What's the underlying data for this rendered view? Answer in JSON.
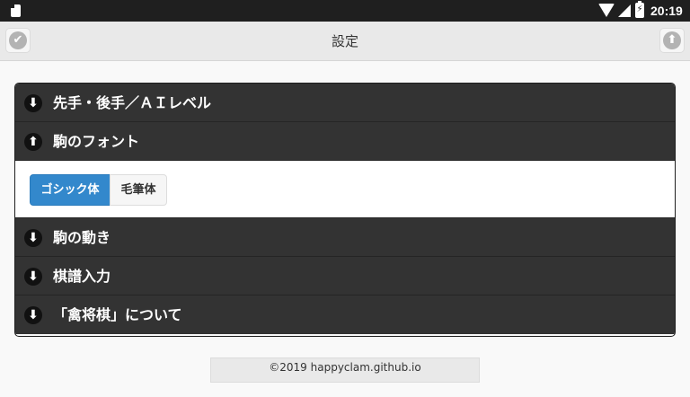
{
  "status_bar": {
    "time": "20:19",
    "icons": [
      "sd-card-icon",
      "wifi-icon",
      "signal-icon",
      "battery-charging-icon"
    ]
  },
  "header": {
    "title": "設定",
    "left_icon": "check-icon",
    "right_icon": "arrow-up-icon"
  },
  "sections": [
    {
      "label": "先手・後手／ＡＩレベル",
      "icon": "arrow-down-icon",
      "expanded": false
    },
    {
      "label": "駒のフォント",
      "icon": "arrow-up-icon",
      "expanded": true
    },
    {
      "label": "駒の動き",
      "icon": "arrow-down-icon",
      "expanded": false
    },
    {
      "label": "棋譜入力",
      "icon": "arrow-down-icon",
      "expanded": false
    },
    {
      "label": "「禽将棋」について",
      "icon": "arrow-down-icon",
      "expanded": false
    }
  ],
  "font_options": {
    "selected": "ゴシック体",
    "options": [
      "ゴシック体",
      "毛筆体"
    ]
  },
  "colors": {
    "accent": "#3388cc",
    "heading_bg": "#333333",
    "page_bg": "#f9f9f9"
  },
  "footer": {
    "text": "©2019 happyclam.github.io"
  }
}
